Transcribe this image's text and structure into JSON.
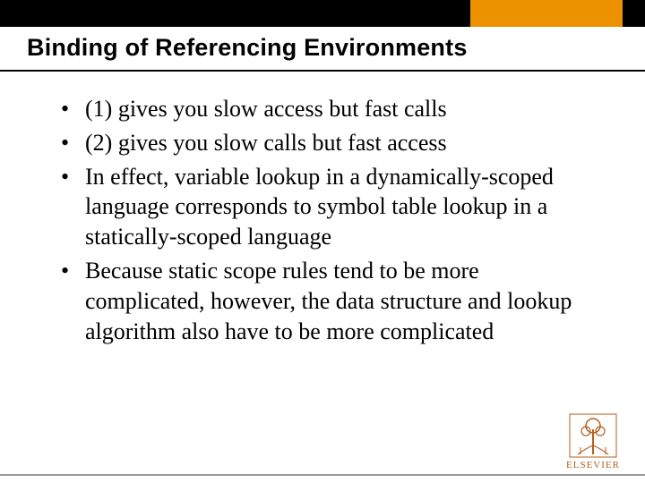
{
  "colors": {
    "accent": "#ec9100",
    "logo": "#b45f1f"
  },
  "slide": {
    "title": "Binding of Referencing Environments",
    "bullets": [
      "(1) gives you slow access but fast calls",
      "(2) gives you slow calls but fast access",
      "In effect, variable lookup in a dynamically-scoped language corresponds to symbol table lookup in a statically-scoped language",
      "Because static scope rules tend to be more complicated, however, the data structure and lookup algorithm also have to be more complicated"
    ]
  },
  "publisher": {
    "name": "ELSEVIER"
  }
}
